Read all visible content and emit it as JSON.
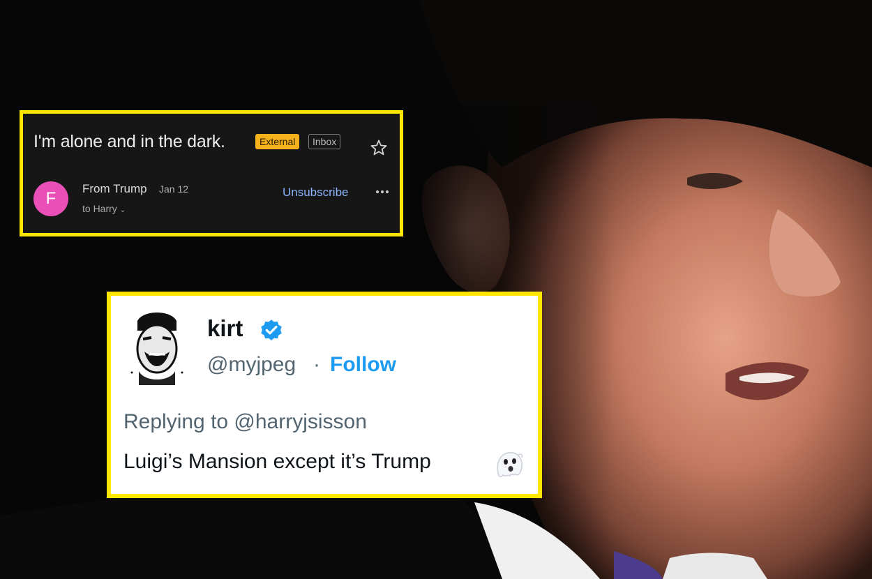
{
  "email": {
    "subject": "I'm alone and in the dark.",
    "badges": {
      "external": "External",
      "inbox": "Inbox"
    },
    "avatar_letter": "F",
    "sender": "From Trump",
    "date": "Jan 12",
    "recipient": "to Harry",
    "unsubscribe": "Unsubscribe",
    "icons": {
      "star": "star-icon",
      "more": "more-vert-icon",
      "chevron": "chevron-down-icon"
    },
    "colors": {
      "highlight_border": "#ffe600",
      "badge_external": "#f6b21b",
      "avatar_bg": "#e94fb6",
      "link": "#8ab4f8"
    }
  },
  "tweet": {
    "display_name": "kirt",
    "handle": "@myjpeg",
    "separator": "·",
    "follow": "Follow",
    "replying_to": "Replying to @harryjsisson",
    "text": "Luigi’s Mansion except it’s Trump",
    "icons": {
      "verified": "verified-badge-icon",
      "ghost": "ghost-emoji-icon"
    },
    "colors": {
      "follow": "#1d9bf0",
      "verified": "#1d9bf0"
    }
  }
}
